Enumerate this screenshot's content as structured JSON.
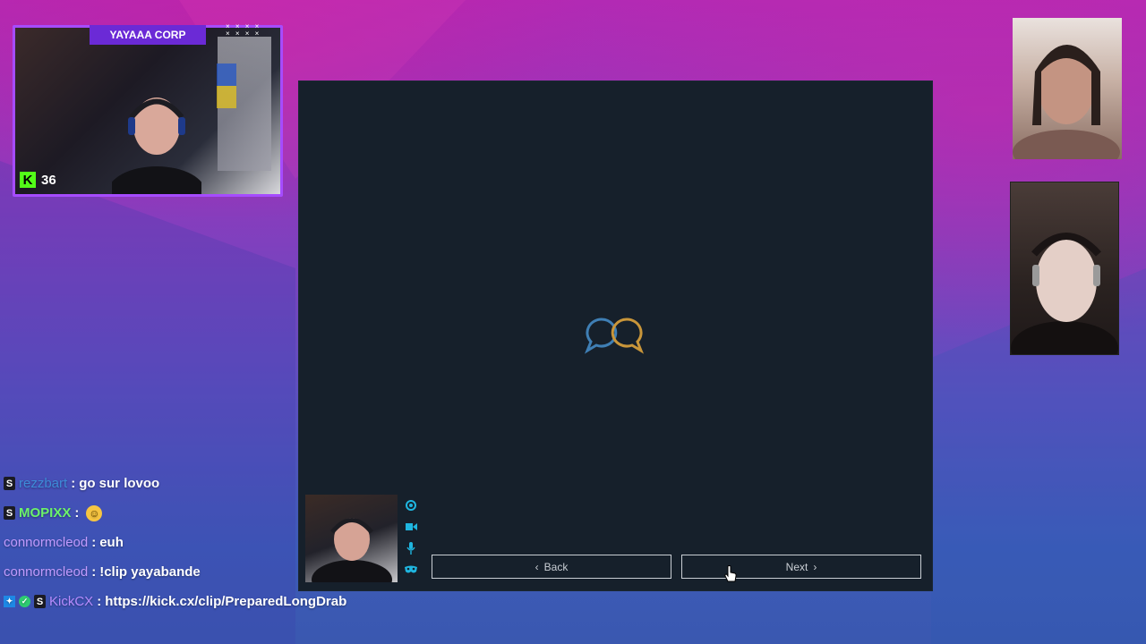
{
  "stream_overlay": {
    "title": "YAYAAA CORP",
    "kick_count": "36"
  },
  "app": {
    "back_label": "Back",
    "next_label": "Next"
  },
  "chat": {
    "messages": [
      {
        "user": "rezzbart",
        "text": "go sur lovoo"
      },
      {
        "user": "MOPIXX",
        "text": ""
      },
      {
        "user": "connormcleod",
        "text": "euh"
      },
      {
        "user": "connormcleod",
        "text": "!clip yayabande"
      },
      {
        "user": "KickCX",
        "text": "https://kick.cx/clip/PreparedLongDrab"
      }
    ]
  },
  "colors": {
    "accent_purple": "#a64cff",
    "kick_green": "#53fc18",
    "logo_blue": "#3f7fb5",
    "logo_gold": "#c9963a",
    "side_icon_cyan": "#1fb6e0"
  }
}
